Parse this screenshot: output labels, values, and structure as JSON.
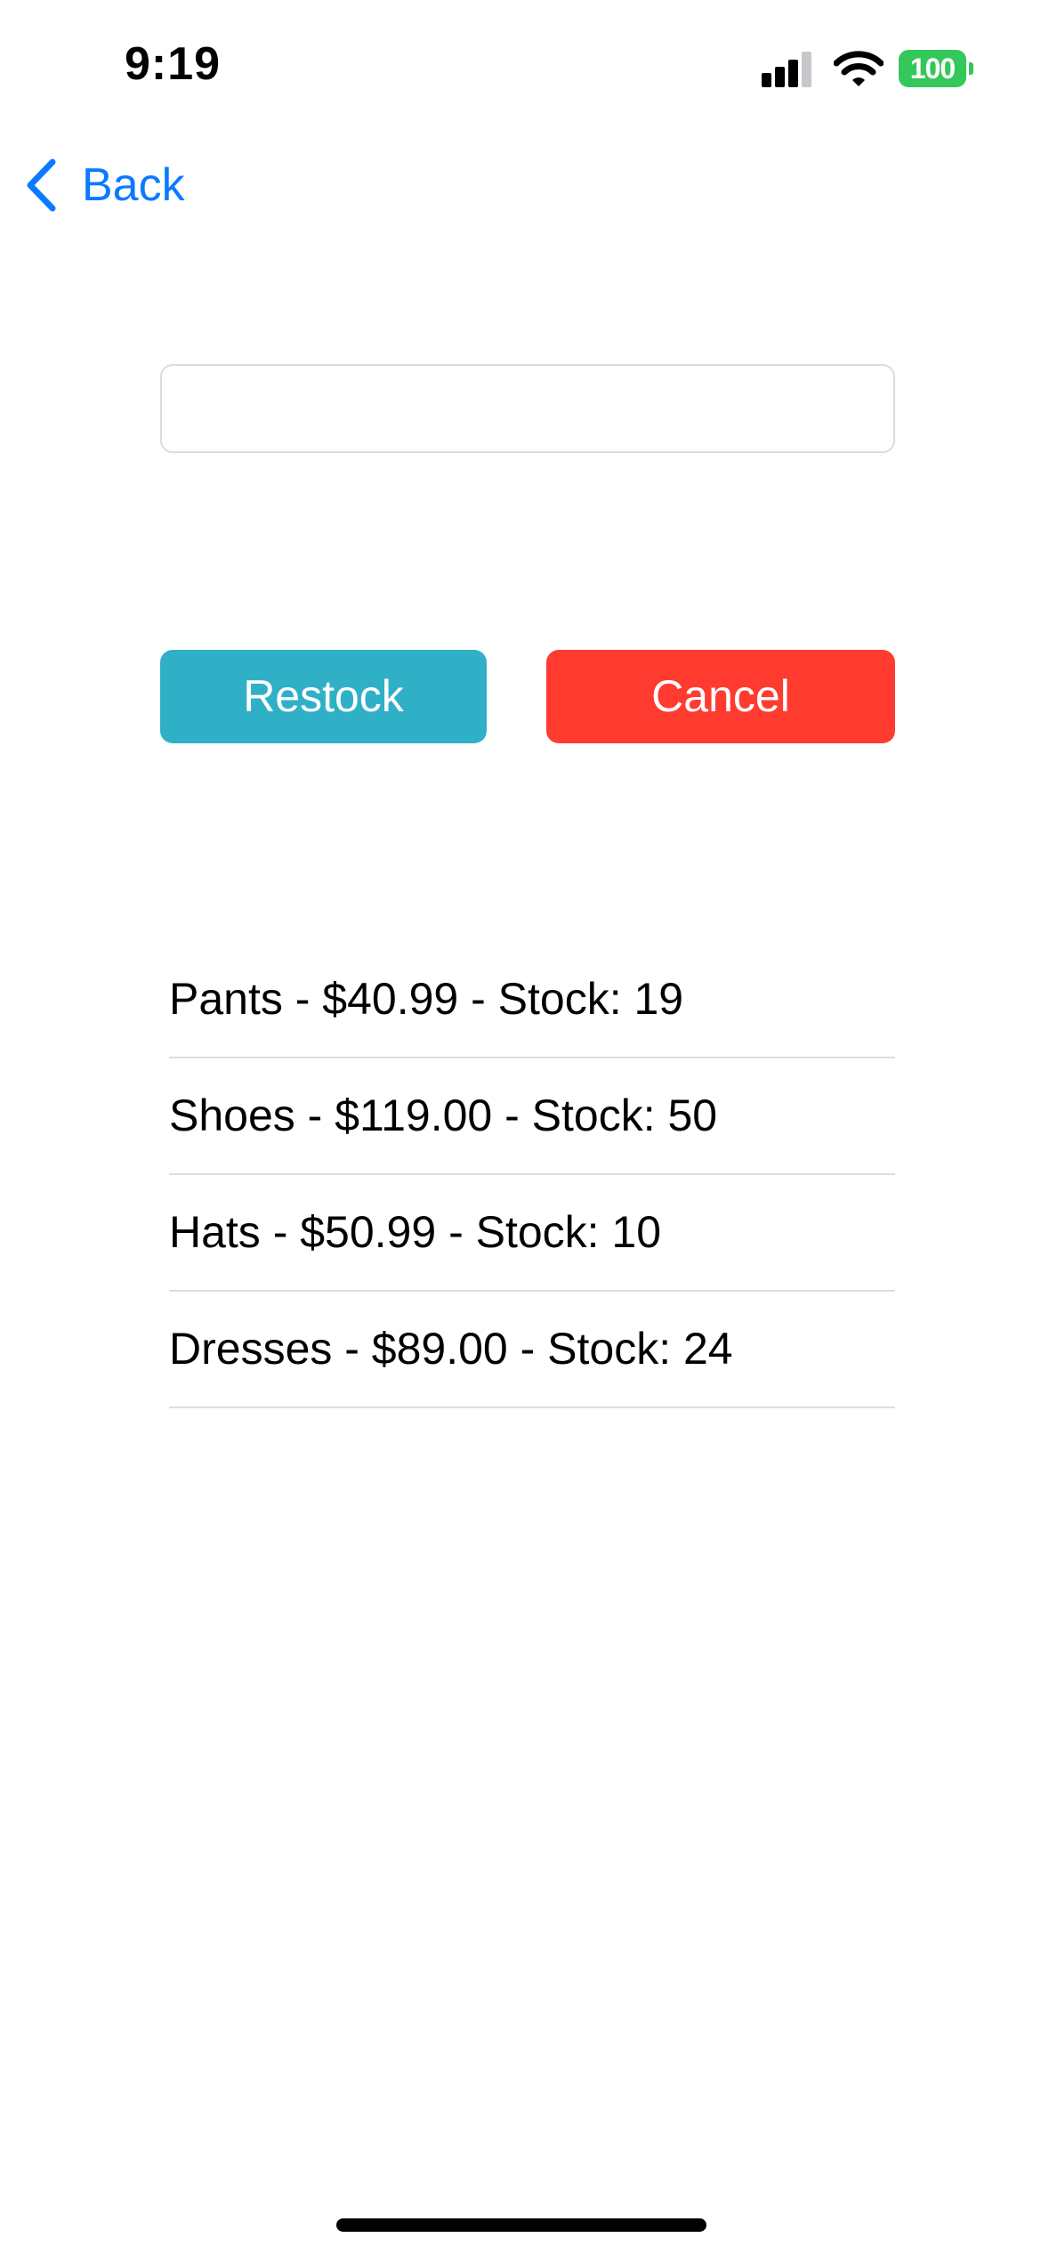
{
  "status_bar": {
    "time": "9:19",
    "battery_level": "100",
    "signal_bars_active": 3,
    "signal_bars_total": 4,
    "battery_color": "#34c759"
  },
  "nav": {
    "back_label": "Back",
    "back_icon": "chevron-left-icon",
    "accent_color": "#0a7aff"
  },
  "input": {
    "value": "",
    "placeholder": ""
  },
  "buttons": {
    "restock_label": "Restock",
    "restock_color": "#30b0c7",
    "cancel_label": "Cancel",
    "cancel_color": "#ff3b30"
  },
  "inventory": [
    "Pants - $40.99 - Stock: 19",
    "Shoes - $119.00 - Stock: 50",
    "Hats - $50.99 - Stock: 10",
    "Dresses - $89.00 - Stock: 24"
  ]
}
